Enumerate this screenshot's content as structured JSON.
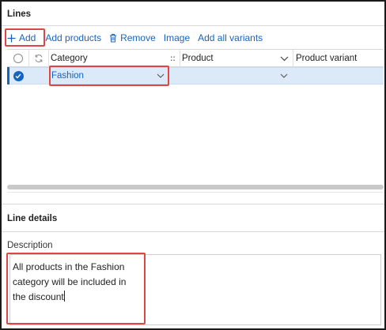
{
  "lines": {
    "title": "Lines",
    "toolbar": {
      "add_label": "Add",
      "add_products_label": "Add products",
      "remove_label": "Remove",
      "image_label": "Image",
      "add_all_variants_label": "Add all variants"
    },
    "grid": {
      "columns": {
        "category": "Category",
        "product": "Product",
        "product_variant": "Product variant"
      },
      "rows": [
        {
          "category": "Fashion",
          "product": "",
          "product_variant": ""
        }
      ]
    }
  },
  "line_details": {
    "title": "Line details",
    "description_label": "Description",
    "description_value": "All products in the Fashion\ncategory will be included in\nthe discount"
  },
  "colors": {
    "accent": "#1565c0",
    "highlight": "#e04444",
    "selected_row": "#dbe9f8"
  }
}
